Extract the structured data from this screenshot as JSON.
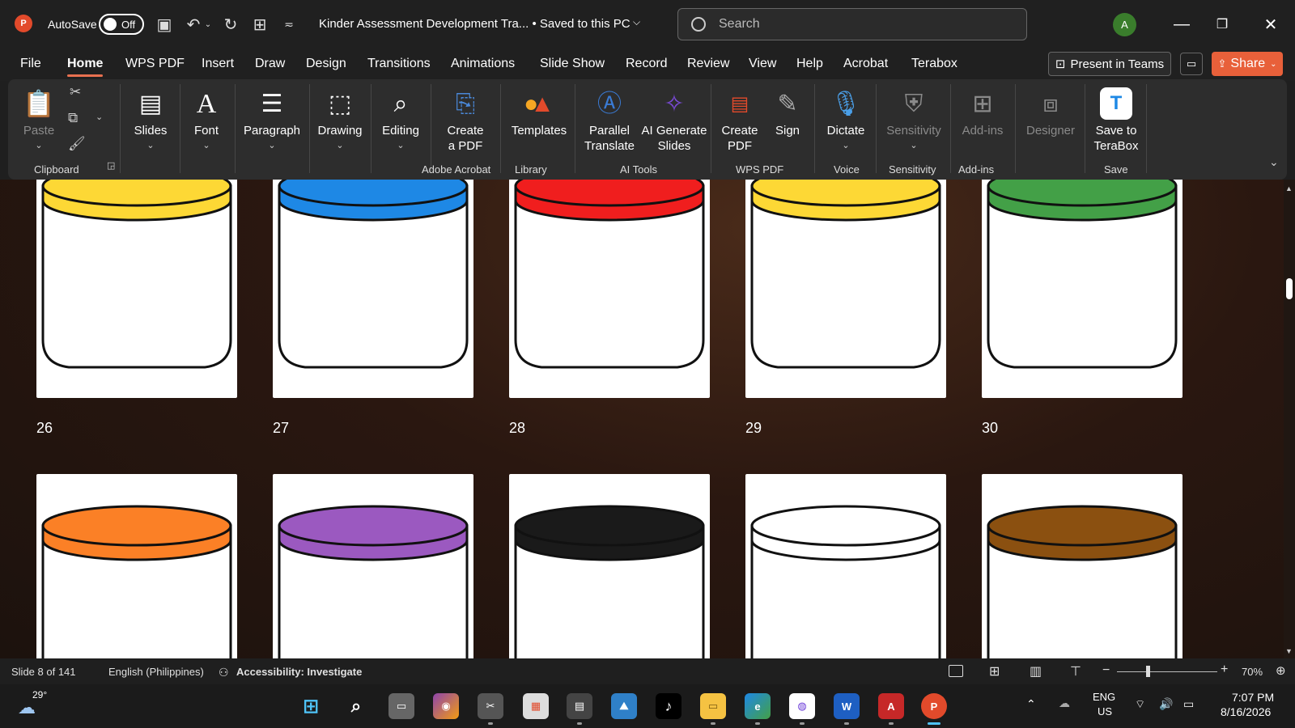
{
  "app": {
    "logo_letter": "P",
    "autosave_label": "AutoSave",
    "autosave_state": "Off",
    "doc_title": "Kinder Assessment Development Tra...  •  Saved to this PC",
    "search_placeholder": "Search",
    "avatar_letter": "A"
  },
  "menu": {
    "tabs": [
      "File",
      "Home",
      "WPS PDF",
      "Insert",
      "Draw",
      "Design",
      "Transitions",
      "Animations",
      "Slide Show",
      "Record",
      "Review",
      "View",
      "Help",
      "Acrobat",
      "Terabox"
    ],
    "active_tab": "Home",
    "present_in_teams": "Present in Teams",
    "share": "Share"
  },
  "ribbon": {
    "paste": "Paste",
    "slides": "Slides",
    "font": "Font",
    "paragraph": "Paragraph",
    "drawing": "Drawing",
    "editing": "Editing",
    "create_pdf_line1": "Create",
    "create_pdf_line2": "a PDF",
    "templates": "Templates",
    "parallel_line1": "Parallel",
    "parallel_line2": "Translate",
    "ai_gen_line1": "AI Generate",
    "ai_gen_line2": "Slides",
    "wps_create_line1": "Create",
    "wps_create_line2": "PDF",
    "sign": "Sign",
    "dictate": "Dictate",
    "sensitivity": "Sensitivity",
    "addins": "Add-ins",
    "designer": "Designer",
    "terabox_line1": "Save to",
    "terabox_line2": "TeraBox",
    "groups": {
      "clipboard": "Clipboard",
      "adobe": "Adobe Acrobat",
      "library": "Library",
      "ai_tools": "AI Tools",
      "wps_pdf": "WPS PDF",
      "voice": "Voice",
      "sensitivity": "Sensitivity",
      "addins": "Add-ins",
      "save": "Save"
    }
  },
  "slides": {
    "row1": [
      {
        "num": "26",
        "lid": "#fdd835"
      },
      {
        "num": "27",
        "lid": "#1e88e5"
      },
      {
        "num": "28",
        "lid": "#f01e1e"
      },
      {
        "num": "29",
        "lid": "#fdd835"
      },
      {
        "num": "30",
        "lid": "#43a047"
      }
    ],
    "row2": [
      {
        "lid": "#fb8026"
      },
      {
        "lid": "#9b59c0"
      },
      {
        "lid": "#1a1a1a"
      },
      {
        "lid": "#ffffff"
      },
      {
        "lid": "#8b5010"
      }
    ]
  },
  "status": {
    "slide_info": "Slide 8 of 141",
    "language": "English (Philippines)",
    "accessibility": "Accessibility: Investigate",
    "zoom": "70%"
  },
  "taskbar": {
    "temp": "29°",
    "lang_line1": "ENG",
    "lang_line2": "US",
    "time": "7:07 PM",
    "date": "8/16/2026"
  }
}
